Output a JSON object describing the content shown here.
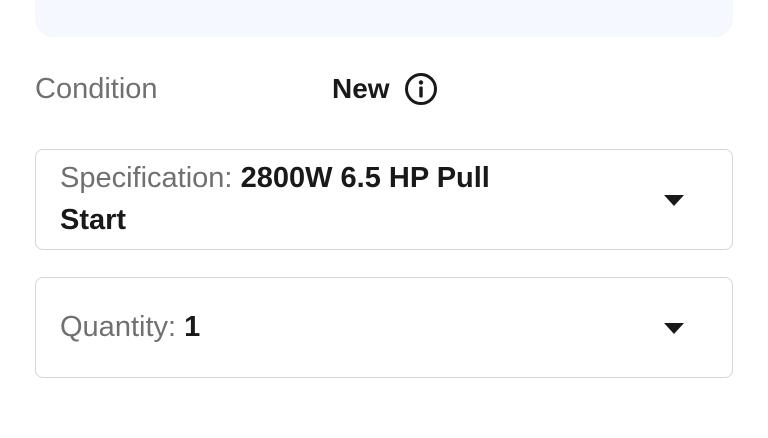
{
  "condition": {
    "label": "Condition",
    "value": "New",
    "info_icon": "info-circle-icon"
  },
  "specification": {
    "label": "Specification:",
    "value": "2800W 6.5 HP Pull Start",
    "dropdown_icon": "caret-down-icon"
  },
  "quantity": {
    "label": "Quantity:",
    "value": "1",
    "dropdown_icon": "caret-down-icon"
  },
  "colors": {
    "banner_bg": "#f5f8fe",
    "label_gray": "#707070",
    "text_dark": "#191919",
    "border": "#d6d6d6"
  }
}
